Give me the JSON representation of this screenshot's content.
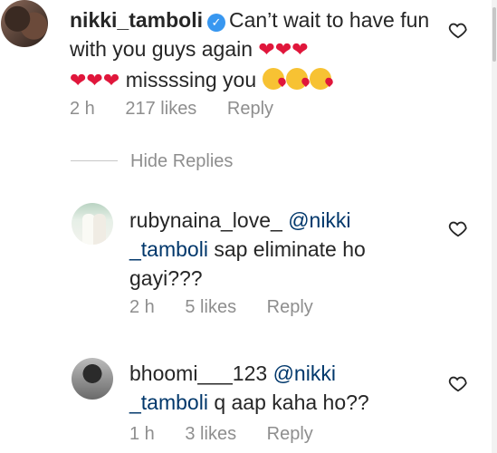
{
  "comments": [
    {
      "username": "nikki_tamboli",
      "verified": true,
      "text": "Can’t wait to have fun with you guys again",
      "text2": "missssing you",
      "emoji_hearts": "❤❤❤",
      "emoji_hearts2": "❤❤❤",
      "emoji_kiss_count": 3,
      "time": "2 h",
      "likes": "217 likes",
      "reply_label": "Reply"
    }
  ],
  "hide_replies_label": "Hide Replies",
  "replies": [
    {
      "username": "rubynaina_love_",
      "mention": "@nikki _tamboli",
      "mention_line1": "@nikki",
      "mention_line2": "_tamboli",
      "text": "sap eliminate ho",
      "text2": "gayi???",
      "time": "2 h",
      "likes": "5 likes",
      "reply_label": "Reply"
    },
    {
      "username": "bhoomi___123",
      "mention_line1": "@nikki",
      "mention_line2": "_tamboli",
      "text": "q aap kaha ho??",
      "time": "1 h",
      "likes": "3 likes",
      "reply_label": "Reply"
    }
  ],
  "icons": {
    "verified": "verified-badge-icon",
    "like": "heart-outline-icon"
  },
  "colors": {
    "text": "#262626",
    "muted": "#8e8e8e",
    "mention": "#00376b",
    "verified": "#3897f0",
    "heart": "#e0163b"
  }
}
